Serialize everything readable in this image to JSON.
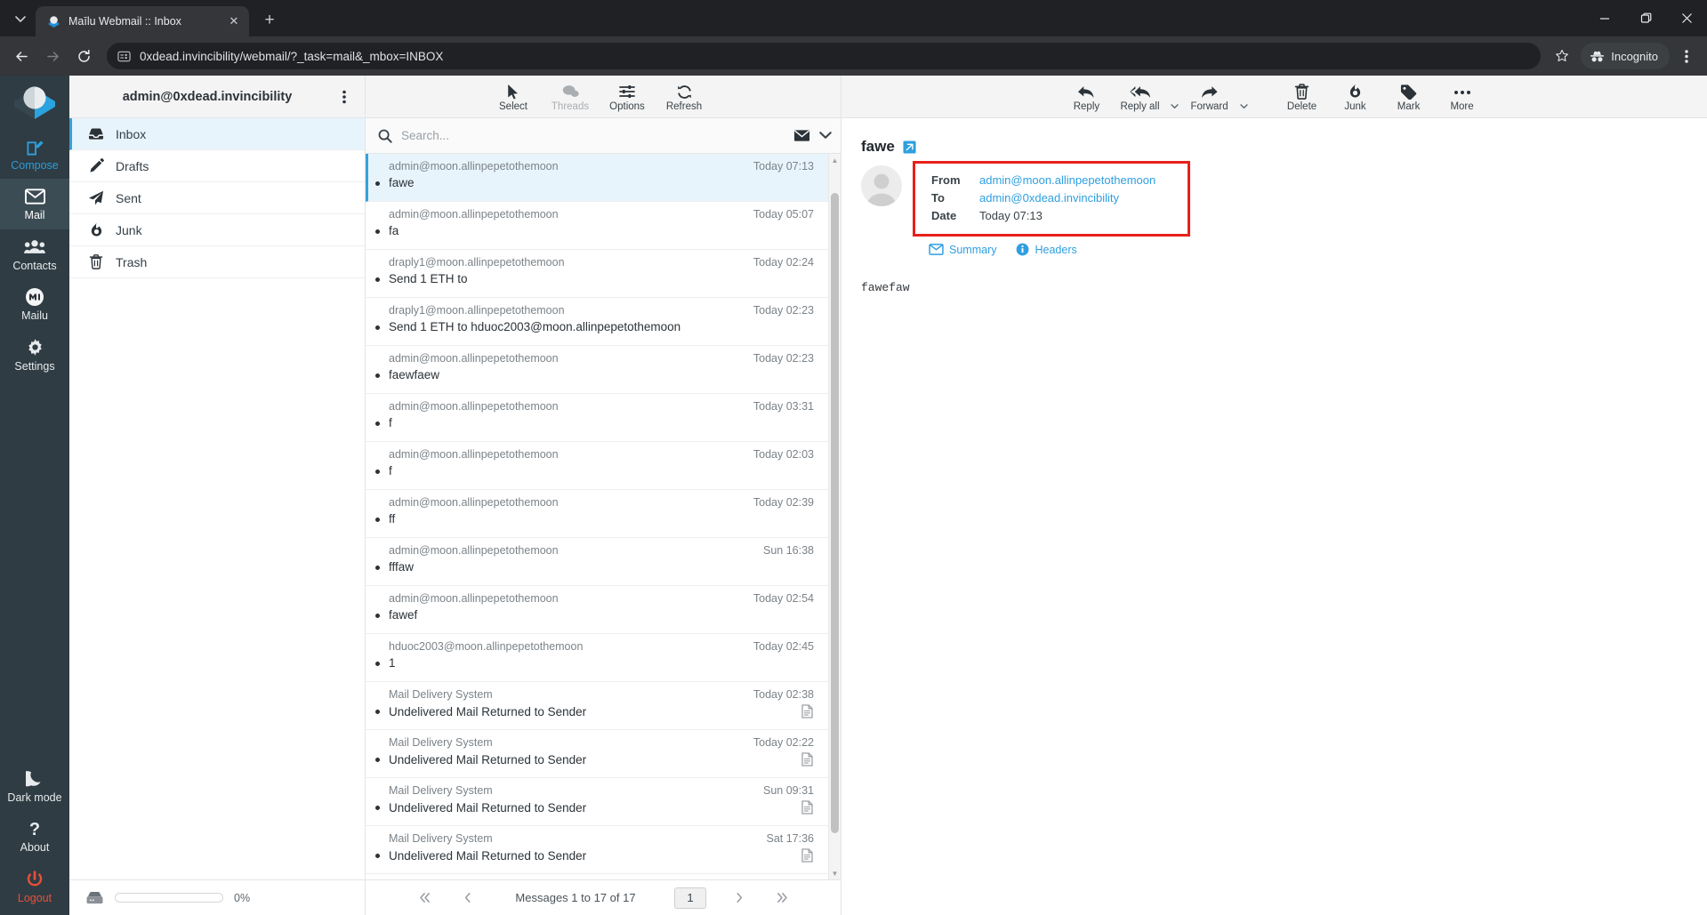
{
  "browser": {
    "tab": {
      "title": "Maīlu Webmail :: Inbox",
      "close_label": "✕",
      "favicon": "mailu-favicon"
    },
    "new_tab_label": "+",
    "tab_search_icon": "chevron-down-icon",
    "window": {
      "minimize": "—",
      "maximize": "❐",
      "close": "✕"
    },
    "nav": {
      "back": "←",
      "forward": "→",
      "reload": "⟳"
    },
    "url": "0xdead.invincibility/webmail/?_task=mail&_mbox=INBOX",
    "site_info_icon": "site-settings-icon",
    "bookmark_icon": "star-icon",
    "incognito_label": "Incognito",
    "menu_icon": "kebab-menu-icon"
  },
  "rail": {
    "logo": "mailu-logo",
    "items": [
      {
        "label": "Compose",
        "icon": "compose-icon",
        "style": "accent"
      },
      {
        "label": "Mail",
        "icon": "envelope-icon",
        "style": "active"
      },
      {
        "label": "Contacts",
        "icon": "contacts-icon",
        "style": "plain"
      },
      {
        "label": "Mailu",
        "icon": "mailu-badge-icon",
        "style": "plain"
      },
      {
        "label": "Settings",
        "icon": "gear-icon",
        "style": "plain"
      }
    ],
    "bottom_items": [
      {
        "label": "Dark mode",
        "icon": "moon-icon",
        "style": "plain"
      },
      {
        "label": "About",
        "icon": "question-mark-icon",
        "style": "plain"
      },
      {
        "label": "Logout",
        "icon": "power-icon",
        "style": "danger"
      }
    ]
  },
  "folders": {
    "account": "admin@0xdead.invincibility",
    "options_icon": "kebab-menu-icon",
    "items": [
      {
        "label": "Inbox",
        "icon": "inbox-icon",
        "selected": true
      },
      {
        "label": "Drafts",
        "icon": "pencil-icon",
        "selected": false
      },
      {
        "label": "Sent",
        "icon": "paper-plane-icon",
        "selected": false
      },
      {
        "label": "Junk",
        "icon": "fire-icon",
        "selected": false
      },
      {
        "label": "Trash",
        "icon": "trash-icon",
        "selected": false
      }
    ],
    "quota": {
      "icon": "disk-icon",
      "percent_label": "0%",
      "percent_value": 0
    }
  },
  "list_toolbar": {
    "buttons": [
      {
        "label": "Select",
        "icon": "cursor-icon",
        "disabled": false
      },
      {
        "label": "Threads",
        "icon": "threads-icon",
        "disabled": true
      },
      {
        "label": "Options",
        "icon": "sliders-icon",
        "disabled": false
      },
      {
        "label": "Refresh",
        "icon": "refresh-icon",
        "disabled": false
      }
    ]
  },
  "search": {
    "placeholder": "Search...",
    "icon": "search-icon",
    "scope_icon": "envelope-icon",
    "dropdown_icon": "chevron-down-icon"
  },
  "messages": [
    {
      "from": "admin@moon.allinpepetothemoon",
      "date": "Today 07:13",
      "subject": "fawe",
      "unread": true,
      "attachment": false,
      "selected": true
    },
    {
      "from": "admin@moon.allinpepetothemoon",
      "date": "Today 05:07",
      "subject": "fa",
      "unread": true,
      "attachment": false,
      "selected": false
    },
    {
      "from": "draply1@moon.allinpepetothemoon",
      "date": "Today 02:24",
      "subject": "Send 1 ETH to",
      "unread": true,
      "attachment": false,
      "selected": false
    },
    {
      "from": "draply1@moon.allinpepetothemoon",
      "date": "Today 02:23",
      "subject": "Send 1 ETH to hduoc2003@moon.allinpepetothemoon",
      "unread": true,
      "attachment": false,
      "selected": false
    },
    {
      "from": "admin@moon.allinpepetothemoon",
      "date": "Today 02:23",
      "subject": "faewfaew",
      "unread": true,
      "attachment": false,
      "selected": false
    },
    {
      "from": "admin@moon.allinpepetothemoon",
      "date": "Today 03:31",
      "subject": "f",
      "unread": true,
      "attachment": false,
      "selected": false
    },
    {
      "from": "admin@moon.allinpepetothemoon",
      "date": "Today 02:03",
      "subject": "f",
      "unread": true,
      "attachment": false,
      "selected": false
    },
    {
      "from": "admin@moon.allinpepetothemoon",
      "date": "Today 02:39",
      "subject": "ff",
      "unread": true,
      "attachment": false,
      "selected": false
    },
    {
      "from": "admin@moon.allinpepetothemoon",
      "date": "Sun 16:38",
      "subject": "fffaw",
      "unread": true,
      "attachment": false,
      "selected": false
    },
    {
      "from": "admin@moon.allinpepetothemoon",
      "date": "Today 02:54",
      "subject": "fawef",
      "unread": true,
      "attachment": false,
      "selected": false
    },
    {
      "from": "hduoc2003@moon.allinpepetothemoon",
      "date": "Today 02:45",
      "subject": "1",
      "unread": true,
      "attachment": false,
      "selected": false
    },
    {
      "from": "Mail Delivery System",
      "date": "Today 02:38",
      "subject": "Undelivered Mail Returned to Sender",
      "unread": true,
      "attachment": true,
      "selected": false
    },
    {
      "from": "Mail Delivery System",
      "date": "Today 02:22",
      "subject": "Undelivered Mail Returned to Sender",
      "unread": true,
      "attachment": true,
      "selected": false
    },
    {
      "from": "Mail Delivery System",
      "date": "Sun 09:31",
      "subject": "Undelivered Mail Returned to Sender",
      "unread": true,
      "attachment": true,
      "selected": false
    },
    {
      "from": "Mail Delivery System",
      "date": "Sat 17:36",
      "subject": "Undelivered Mail Returned to Sender",
      "unread": true,
      "attachment": true,
      "selected": false
    }
  ],
  "pagination": {
    "first_icon": "double-chevron-left-icon",
    "prev_icon": "chevron-left-icon",
    "status": "Messages 1 to 17 of 17",
    "page_value": "1",
    "next_icon": "chevron-right-icon",
    "last_icon": "double-chevron-right-icon"
  },
  "preview_toolbar": {
    "buttons": [
      {
        "label": "Reply",
        "icon": "reply-icon",
        "caret": false
      },
      {
        "label": "Reply all",
        "icon": "reply-all-icon",
        "caret": true
      },
      {
        "label": "Forward",
        "icon": "forward-icon",
        "caret": true
      },
      {
        "label": "Delete",
        "icon": "trash-icon",
        "caret": false
      },
      {
        "label": "Junk",
        "icon": "fire-icon",
        "caret": false
      },
      {
        "label": "Mark",
        "icon": "tag-icon",
        "caret": false
      },
      {
        "label": "More",
        "icon": "ellipsis-icon",
        "caret": false
      }
    ]
  },
  "preview": {
    "subject": "fawe",
    "open_new_window_icon": "external-link-icon",
    "avatar_icon": "person-avatar-icon",
    "headers": [
      {
        "label": "From",
        "value": "admin@moon.allinpepetothemoon",
        "link": true
      },
      {
        "label": "To",
        "value": "admin@0xdead.invincibility",
        "link": true
      },
      {
        "label": "Date",
        "value": "Today 07:13",
        "link": false
      }
    ],
    "links": [
      {
        "label": "Summary",
        "icon": "envelope-icon"
      },
      {
        "label": "Headers",
        "icon": "info-icon"
      }
    ],
    "body": "fawefaw"
  },
  "colors": {
    "rail_bg": "#2f3c43",
    "accent": "#2c9cd8",
    "link": "#2f9fe0",
    "selection_bg": "#e8f4fc",
    "highlight_box": "#e8201a",
    "danger": "#e8503a"
  }
}
